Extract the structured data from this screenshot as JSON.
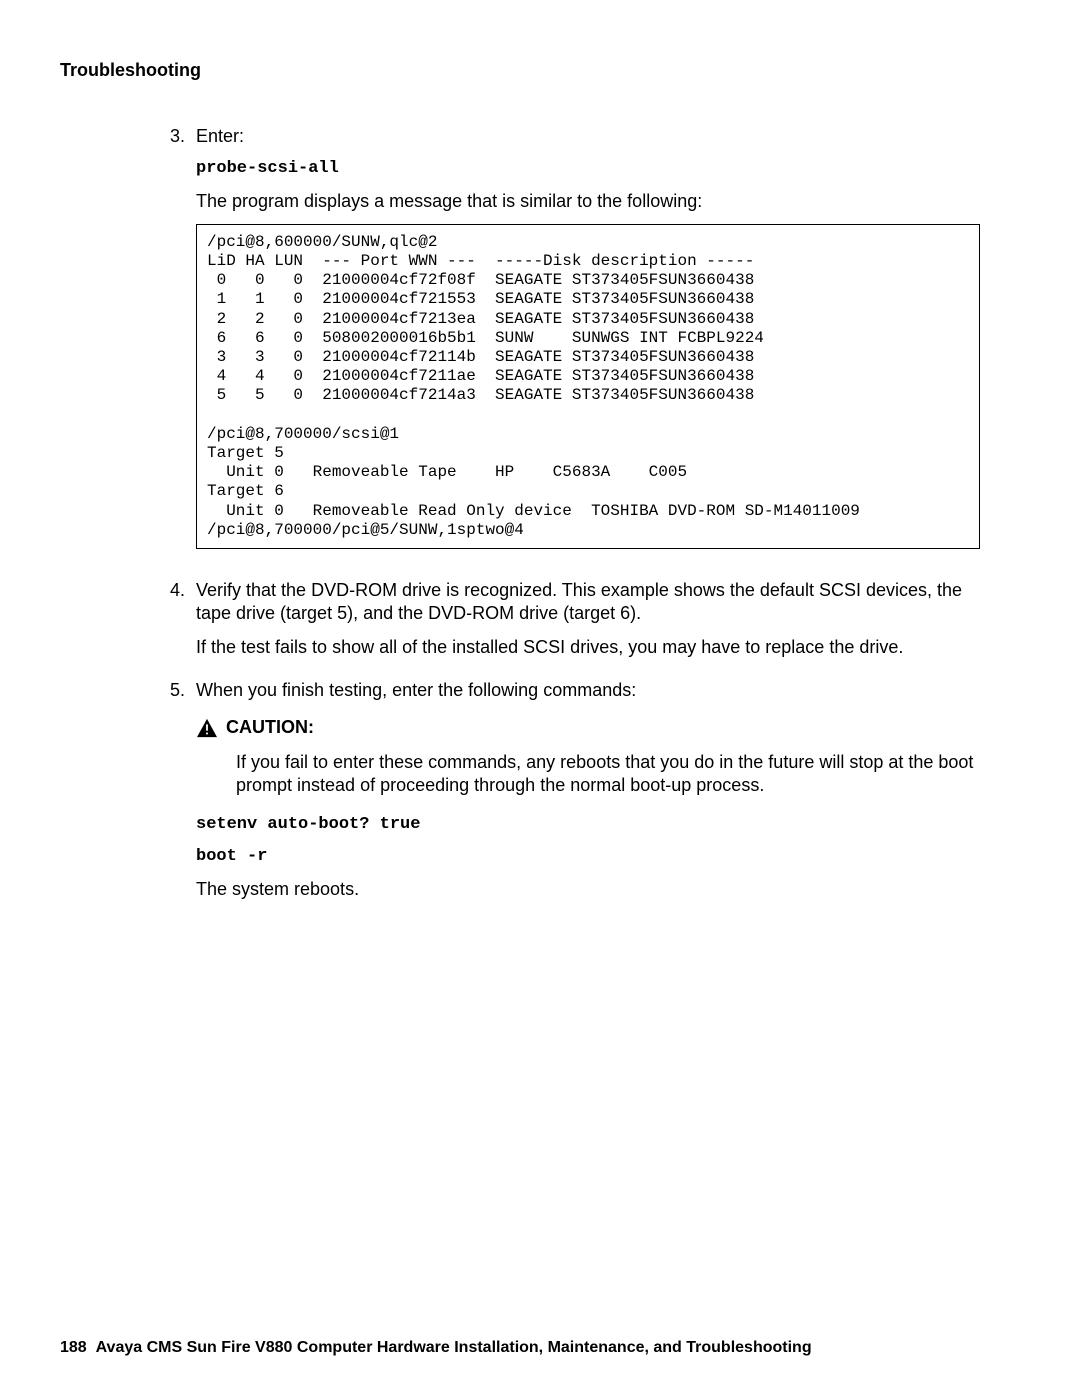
{
  "header": {
    "section": "Troubleshooting"
  },
  "steps": {
    "s3": {
      "num": "3.",
      "intro": "Enter:",
      "cmd": "probe-scsi-all",
      "after": "The program displays a message that is similar to the following:"
    },
    "code_block": "/pci@8,600000/SUNW,qlc@2\nLiD HA LUN  --- Port WWN ---  -----Disk description -----\n 0   0   0  21000004cf72f08f  SEAGATE ST373405FSUN3660438\n 1   1   0  21000004cf721553  SEAGATE ST373405FSUN3660438\n 2   2   0  21000004cf7213ea  SEAGATE ST373405FSUN3660438\n 6   6   0  508002000016b5b1  SUNW    SUNWGS INT FCBPL9224\n 3   3   0  21000004cf72114b  SEAGATE ST373405FSUN3660438\n 4   4   0  21000004cf7211ae  SEAGATE ST373405FSUN3660438\n 5   5   0  21000004cf7214a3  SEAGATE ST373405FSUN3660438\n\n/pci@8,700000/scsi@1\nTarget 5\n  Unit 0   Removeable Tape    HP    C5683A    C005\nTarget 6\n  Unit 0   Removeable Read Only device  TOSHIBA DVD-ROM SD-M14011009\n/pci@8,700000/pci@5/SUNW,1sptwo@4",
    "s4": {
      "num": "4.",
      "p1": "Verify that the DVD-ROM drive is recognized. This example shows the default SCSI devices, the tape drive (target 5), and the DVD-ROM drive (target 6).",
      "p2": "If the test fails to show all of the installed SCSI drives, you may have to replace the drive."
    },
    "s5": {
      "num": "5.",
      "intro": "When you finish testing, enter the following commands:",
      "caution_label": "CAUTION:",
      "caution_body": "If you fail to enter these commands, any reboots that you do in the future will stop at the boot prompt instead of proceeding through the normal boot-up process.",
      "cmd1": "setenv auto-boot? true",
      "cmd2": "boot -r",
      "after": "The system reboots."
    }
  },
  "footer": {
    "page_num": "188",
    "title": "Avaya CMS Sun Fire V880 Computer Hardware Installation, Maintenance, and Troubleshooting"
  }
}
